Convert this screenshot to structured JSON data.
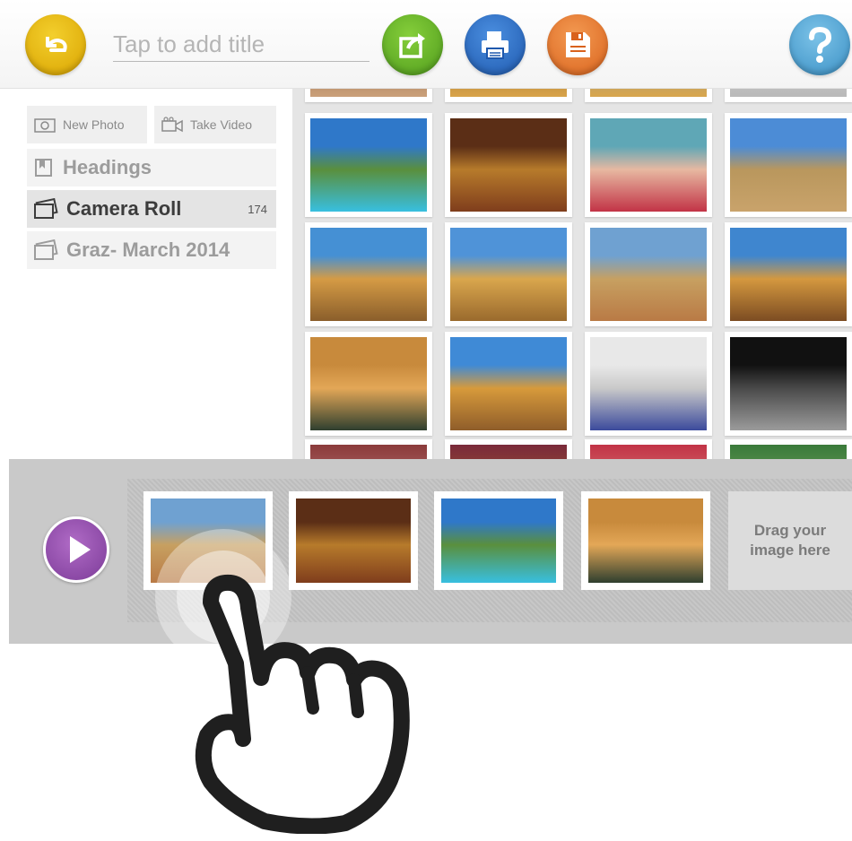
{
  "toolbar": {
    "title_placeholder": "Tap to add title",
    "buttons": {
      "back": {
        "icon": "undo-arrow-icon",
        "color": "#e5b300"
      },
      "share": {
        "icon": "share-icon",
        "color": "#6ab62b"
      },
      "print": {
        "icon": "printer-icon",
        "color": "#2d6fc4"
      },
      "save": {
        "icon": "floppy-disk-icon",
        "color": "#e6762d"
      },
      "help": {
        "icon": "question-mark-icon",
        "color": "#5aa8d6"
      }
    }
  },
  "sidebar": {
    "new_photo": "New Photo",
    "take_video": "Take Video",
    "items": [
      {
        "label": "Headings",
        "icon": "bookmark-icon"
      },
      {
        "label": "Camera Roll",
        "icon": "photo-stack-icon",
        "count": "174",
        "active": true
      },
      {
        "label": "Graz- March 2014",
        "icon": "photo-stack-icon"
      }
    ]
  },
  "grid": {
    "photos": [
      {
        "subject": "pool and mountain",
        "colors": [
          "#2f78c9",
          "#5a8f3d",
          "#38bfe0"
        ]
      },
      {
        "subject": "market olives",
        "colors": [
          "#5b2e16",
          "#b77b2b",
          "#7f3d1c"
        ]
      },
      {
        "subject": "baby",
        "colors": [
          "#5fa7b6",
          "#e7b8a1",
          "#c23346"
        ]
      },
      {
        "subject": "coastal town",
        "colors": [
          "#4c8cd6",
          "#b9975d",
          "#c9a36b"
        ]
      },
      {
        "subject": "yellow building",
        "colors": [
          "#4590d4",
          "#d59b45",
          "#8a5e2b"
        ]
      },
      {
        "subject": "building facade",
        "colors": [
          "#4f93d8",
          "#d9a64d",
          "#9a6a2d"
        ]
      },
      {
        "subject": "seafront houses",
        "colors": [
          "#6fa1d1",
          "#c7a061",
          "#b97a45"
        ]
      },
      {
        "subject": "street building",
        "colors": [
          "#3f86cf",
          "#d4983f",
          "#7c4c22"
        ]
      },
      {
        "subject": "balconies",
        "colors": [
          "#c88a3c",
          "#e3a757",
          "#2f3f2f"
        ]
      },
      {
        "subject": "tall building",
        "colors": [
          "#3f8ad6",
          "#d79a3b",
          "#8f5d2a"
        ]
      },
      {
        "subject": "notes on paper",
        "colors": [
          "#e8e8e8",
          "#c9c9c9",
          "#3b4a9c"
        ]
      },
      {
        "subject": "ultrasound",
        "colors": [
          "#111111",
          "#4a4a4a",
          "#9b9b9b"
        ]
      }
    ]
  },
  "tray": {
    "play_icon": "play-icon",
    "slots": [
      {
        "subject": "seafront houses",
        "colors": [
          "#6fa1d1",
          "#c7a061",
          "#b97a45"
        ]
      },
      {
        "subject": "market olives",
        "colors": [
          "#5b2e16",
          "#b77b2b",
          "#7f3d1c"
        ]
      },
      {
        "subject": "pool and mountain",
        "colors": [
          "#2f78c9",
          "#5a8f3d",
          "#38bfe0"
        ]
      },
      {
        "subject": "balconies",
        "colors": [
          "#c88a3c",
          "#e3a757",
          "#2f3f2f"
        ]
      }
    ],
    "drop_text_line1": "Drag your",
    "drop_text_line2": "image here"
  },
  "gesture": {
    "icon": "pointing-hand-icon"
  }
}
